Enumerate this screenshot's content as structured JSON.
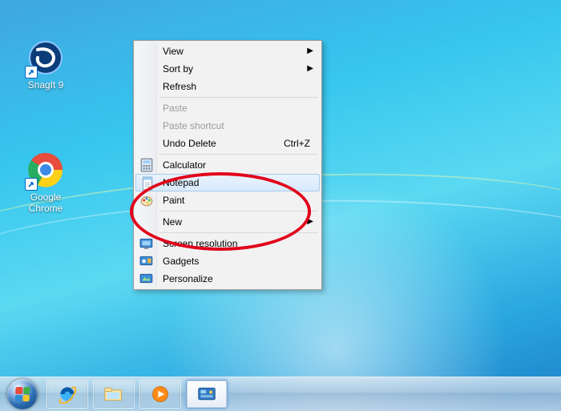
{
  "desktop_icons": {
    "snagit": "SnagIt 9",
    "chrome": "Google Chrome"
  },
  "menu": {
    "view": "View",
    "sortby": "Sort by",
    "refresh": "Refresh",
    "paste": "Paste",
    "paste_shortcut": "Paste shortcut",
    "undo_delete": "Undo Delete",
    "undo_delete_accel": "Ctrl+Z",
    "calculator": "Calculator",
    "notepad": "Notepad",
    "paint": "Paint",
    "new": "New",
    "screen_resolution": "Screen resolution",
    "gadgets": "Gadgets",
    "personalize": "Personalize"
  }
}
